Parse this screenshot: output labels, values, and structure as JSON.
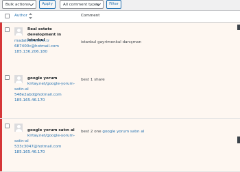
{
  "toolbar": {
    "bulk_actions": "Bulk actions",
    "apply": "Apply",
    "comment_types": "All comment types",
    "filter": "Filter"
  },
  "header": {
    "author": "Author",
    "comment": "Comment"
  },
  "rows": [
    {
      "name": "Real estate development in istanbul",
      "website": "madalikoru.com.tr",
      "email": "687400c@hotmail.com",
      "ip": "185.136.206.180",
      "comment": "istanbul gayrimenkul danışman"
    },
    {
      "name": "google yorum",
      "website": "kirtay.net/google-yorum-satin-al",
      "website_line1": "kirtay.net/google-yorum-",
      "website_line2": "satin-al",
      "email": "548e2abd@hotmail.com",
      "ip": "185.165.46.170",
      "comment": "best 1 share"
    },
    {
      "name": "google yorum satın al",
      "website_line1": "kirtay.net/google-yorum-",
      "website_line2": "satin-al",
      "email": "533c3047@hotmail.com",
      "ip": "185.165.46.170",
      "comment_prefix": "best 2 one ",
      "comment_link": "google yorum satın al"
    }
  ],
  "colors": {
    "accent": "#2271b1",
    "unapproved_bar": "#d63638",
    "unapproved_bg": "#fef7f1"
  }
}
